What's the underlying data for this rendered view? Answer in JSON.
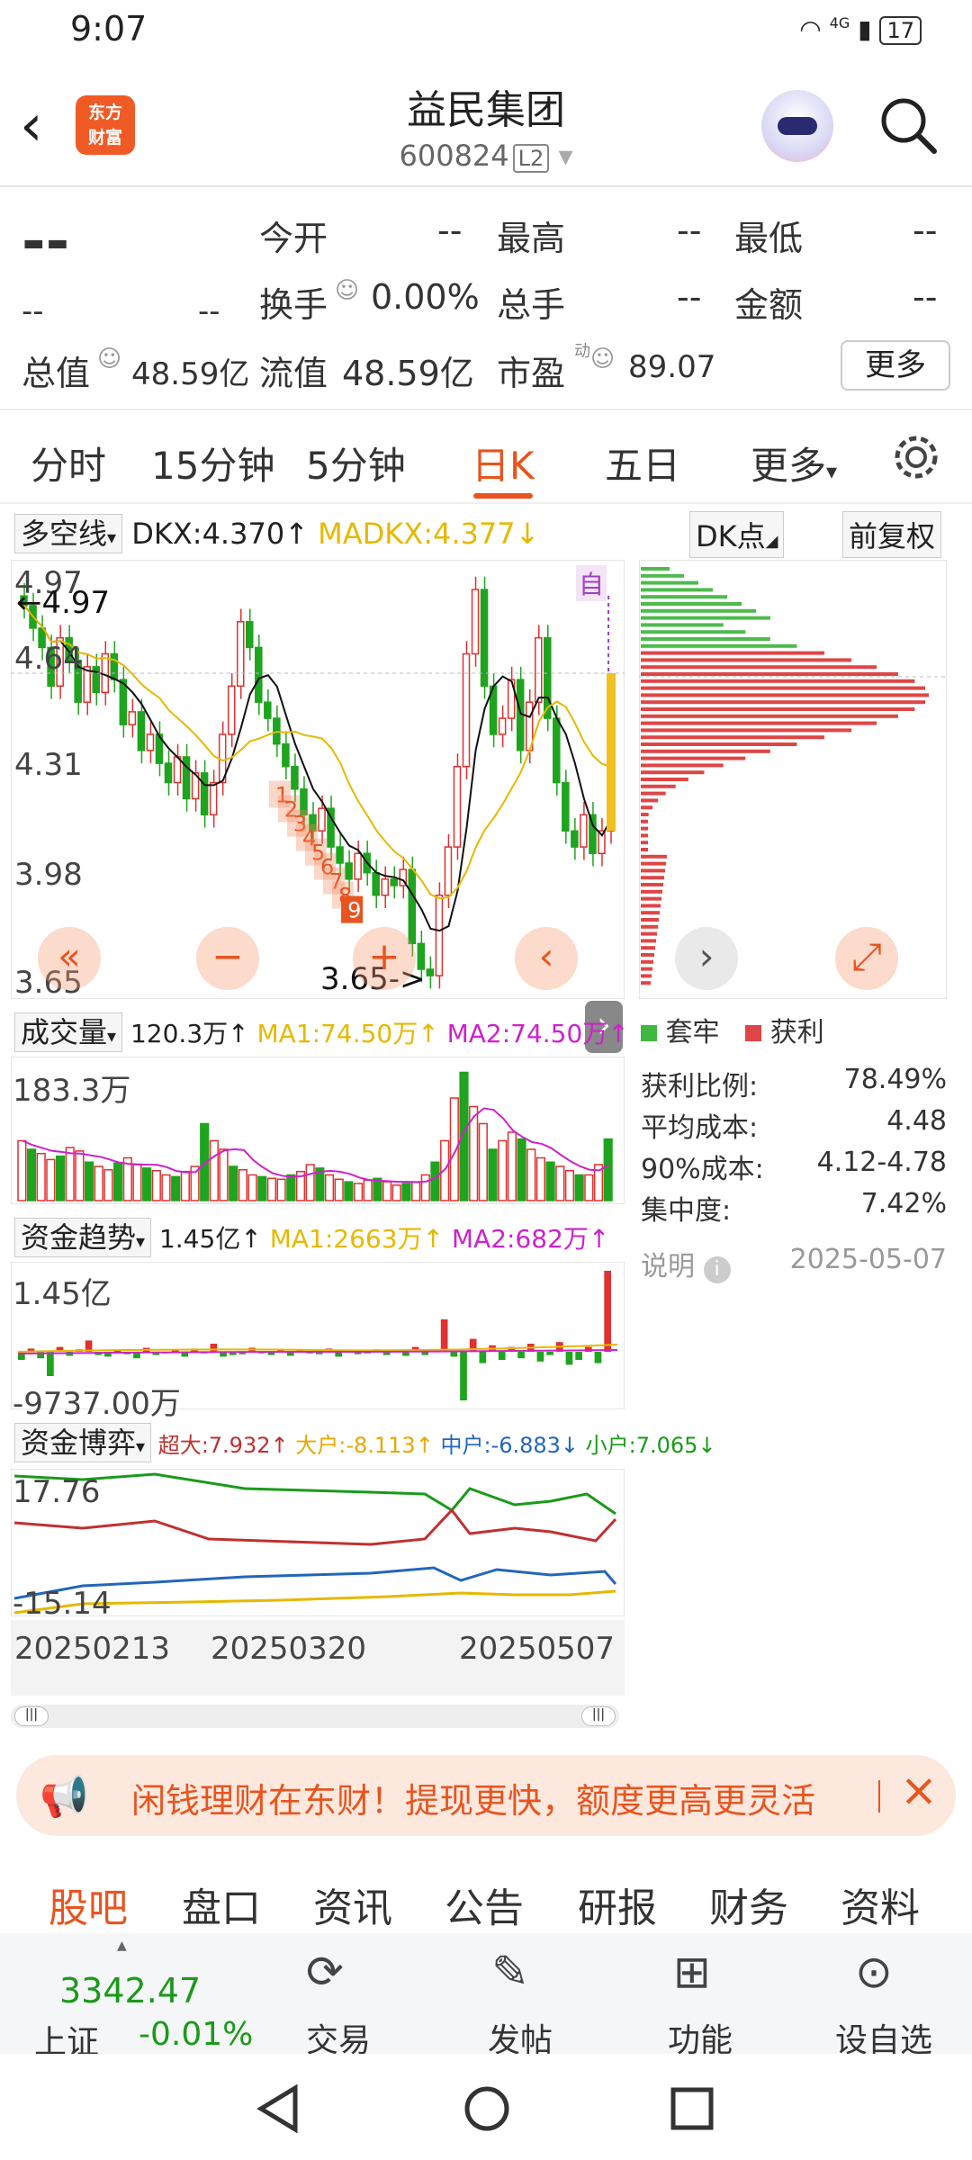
{
  "status": {
    "time": "9:07",
    "network": "4G",
    "battery": "17"
  },
  "header": {
    "title": "益民集团",
    "code": "600824",
    "level": "L2",
    "logo_line1": "东方",
    "logo_line2": "财富"
  },
  "quote": {
    "price": "--",
    "change": "--",
    "change_pct": "--",
    "open_label": "今开",
    "open": "--",
    "high_label": "最高",
    "high": "--",
    "low_label": "最低",
    "low": "--",
    "turnover_label": "换手",
    "turnover": "0.00%",
    "volume_label": "总手",
    "volume": "--",
    "amount_label": "金额",
    "amount": "--",
    "mktcap_label": "总值",
    "mktcap": "48.59亿",
    "float_label": "流值",
    "float": "48.59亿",
    "pe_label": "市盈",
    "pe_sup": "动",
    "pe": "89.07",
    "more_label": "更多"
  },
  "tabs": [
    {
      "label": "分时"
    },
    {
      "label": "15分钟"
    },
    {
      "label": "5分钟"
    },
    {
      "label": "日K"
    },
    {
      "label": "五日"
    },
    {
      "label": "更多"
    }
  ],
  "kchart": {
    "indicator": "多空线",
    "dkx": "DKX:4.370↑",
    "madkx": "MADKX:4.377↓",
    "dk_btn": "DK点",
    "adj_btn": "前复权",
    "ylabels": [
      "4.97",
      "4.64",
      "4.31",
      "3.98",
      "3.65"
    ],
    "high_note": "←4.97",
    "low_note": "3.65->",
    "auto": "自",
    "nine": [
      "1",
      "2",
      "3",
      "4",
      "5",
      "6",
      "7",
      "8",
      "9"
    ]
  },
  "chip": {
    "legend_trap": "套牢",
    "legend_profit": "获利",
    "rows": [
      {
        "label": "获利比例:",
        "value": "78.49%"
      },
      {
        "label": "平均成本:",
        "value": "4.48"
      },
      {
        "label": "90%成本:",
        "value": "4.12-4.78"
      },
      {
        "label": "集中度:",
        "value": "7.42%"
      }
    ],
    "note": "说明",
    "date": "2025-05-07"
  },
  "volume": {
    "label": "成交量",
    "value": "120.3万↑",
    "ma1": "MA1:74.50万↑",
    "ma2": "MA2:74.50万↑",
    "ymax": "183.3万"
  },
  "flow": {
    "label": "资金趋势",
    "value": "1.45亿↑",
    "ma1": "MA1:2663万↑",
    "ma2": "MA2:682万↑",
    "ymax": "1.45亿",
    "ymin": "-9737.00万"
  },
  "game": {
    "label": "资金博弈",
    "super": "超大:7.932↑",
    "big": "大户:-8.113↑",
    "mid": "中户:-6.883↓",
    "small": "小户:7.065↓",
    "ymax": "17.76",
    "ymin": "-15.14"
  },
  "dates": [
    "20250213",
    "20250320",
    "20250507"
  ],
  "banner": {
    "text": "闲钱理财在东财！提现更快，额度更高更灵活"
  },
  "bottom_tabs": [
    "股吧",
    "盘口",
    "资讯",
    "公告",
    "研报",
    "财务",
    "资料"
  ],
  "dock": {
    "index_value": "3342.47",
    "index_name": "上证",
    "index_change": "-0.01%",
    "items": [
      "交易",
      "发帖",
      "功能",
      "设自选"
    ]
  },
  "colors": {
    "up": "#e03030",
    "down": "#1ea41e",
    "accent": "#e8541e",
    "ma_yellow": "#e6b800",
    "ma_magenta": "#cc22cc"
  }
}
